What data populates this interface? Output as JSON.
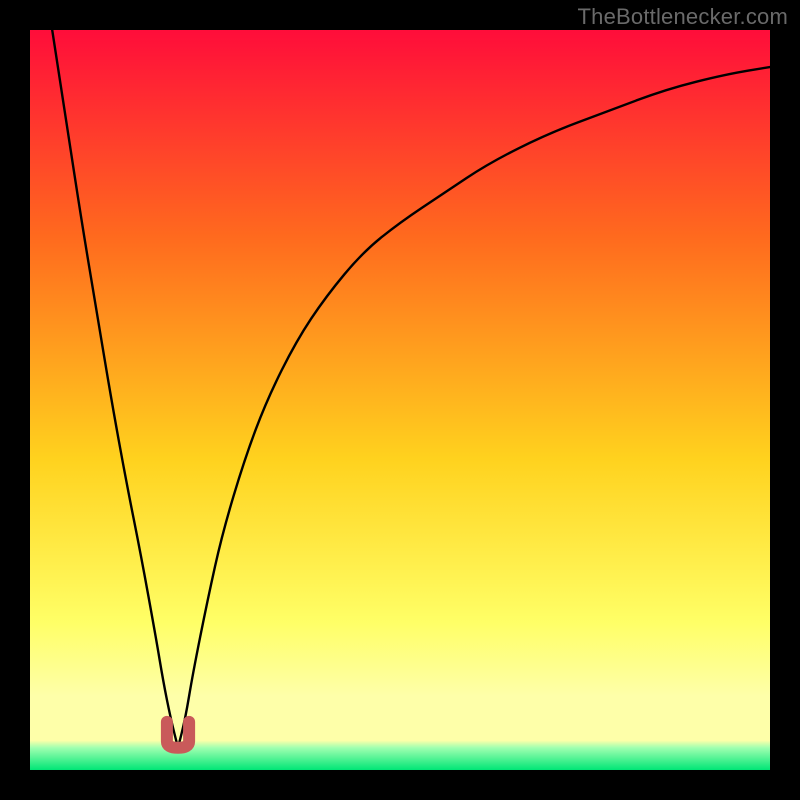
{
  "attribution": "TheBottlenecker.com",
  "colors": {
    "frame": "#000000",
    "gradient_top": "#ff0d3a",
    "gradient_mid1": "#ff6a1e",
    "gradient_mid2": "#ffd21e",
    "gradient_low": "#ffff66",
    "gradient_band_pale": "#feffa9",
    "gradient_bottom": "#00e676",
    "curve": "#000000",
    "marker": "#c95a5a"
  },
  "chart_data": {
    "type": "line",
    "title": "",
    "xlabel": "",
    "ylabel": "",
    "xlim": [
      0,
      100
    ],
    "ylim": [
      0,
      100
    ],
    "minimum": {
      "x": 20,
      "y": 3
    },
    "series": [
      {
        "name": "left-branch",
        "x": [
          3,
          5,
          7,
          9,
          11,
          13,
          15,
          17,
          18,
          19,
          20
        ],
        "y": [
          100,
          87,
          74,
          62,
          50,
          39,
          29,
          18,
          12,
          7,
          3
        ]
      },
      {
        "name": "right-branch",
        "x": [
          20,
          21,
          22,
          24,
          26,
          29,
          32,
          36,
          40,
          45,
          50,
          56,
          62,
          70,
          78,
          86,
          94,
          100
        ],
        "y": [
          3,
          7,
          13,
          23,
          32,
          42,
          50,
          58,
          64,
          70,
          74,
          78,
          82,
          86,
          89,
          92,
          94,
          95
        ]
      }
    ],
    "marker": {
      "name": "u-shape",
      "x": 20,
      "y": 3,
      "width_pct": 3.0,
      "height_pct": 3.5
    }
  }
}
